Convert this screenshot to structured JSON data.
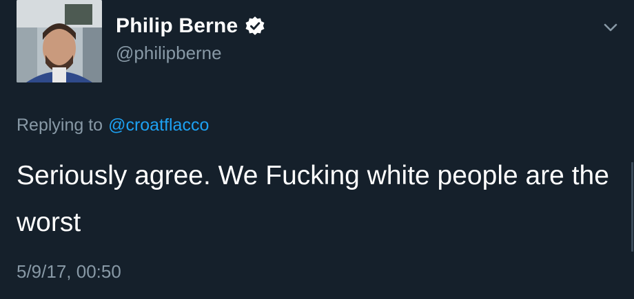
{
  "tweet": {
    "author": {
      "display_name": "Philip Berne",
      "handle": "@philipberne",
      "verified_icon": "verified-badge-icon"
    },
    "reply": {
      "prefix": "Replying to",
      "mention": "@croatflacco"
    },
    "text": "Seriously agree. We Fucking white people are the worst",
    "timestamp": "5/9/17, 00:50",
    "menu_icon": "chevron-down-icon"
  },
  "colors": {
    "background": "#15202b",
    "primary_text": "#ffffff",
    "secondary_text": "#8899a6",
    "link": "#1da1f2"
  }
}
